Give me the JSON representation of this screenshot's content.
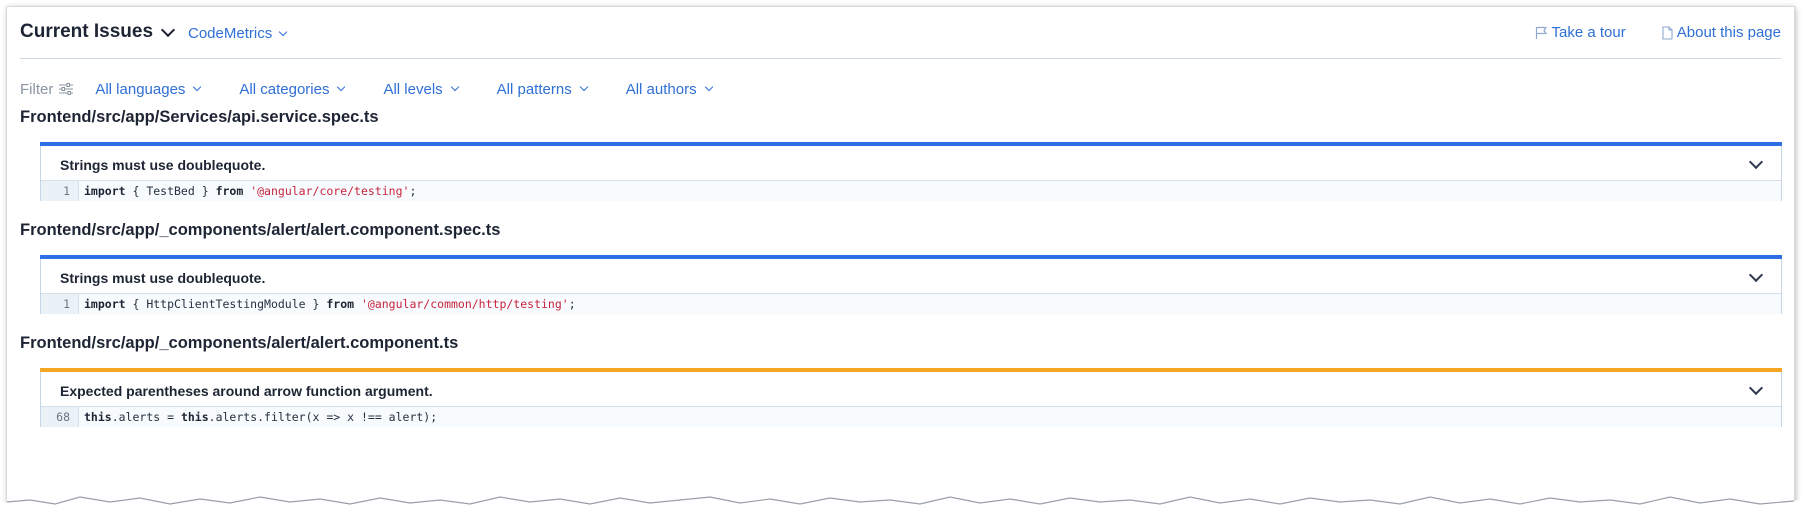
{
  "header": {
    "title": "Current Issues",
    "project": "CodeMetrics",
    "take_tour": "Take a tour",
    "about": "About this page"
  },
  "filters": {
    "label": "Filter",
    "languages": "All languages",
    "categories": "All categories",
    "levels": "All levels",
    "patterns": "All patterns",
    "authors": "All authors"
  },
  "files": [
    {
      "path": "Frontend/src/app/Services/api.service.spec.ts",
      "issue": {
        "message": "Strings must use doublequote.",
        "severity_color": "#2f6fe6",
        "line": "1",
        "code_kw1": "import",
        "code_mid": " { TestBed } ",
        "code_kw2": "from",
        "code_str": "'@angular/core/testing'",
        "code_end": ";"
      }
    },
    {
      "path": "Frontend/src/app/_components/alert/alert.component.spec.ts",
      "issue": {
        "message": "Strings must use doublequote.",
        "severity_color": "#2f6fe6",
        "line": "1",
        "code_kw1": "import",
        "code_mid": " { HttpClientTestingModule } ",
        "code_kw2": "from",
        "code_str": "'@angular/common/http/testing'",
        "code_end": ";"
      }
    },
    {
      "path": "Frontend/src/app/_components/alert/alert.component.ts",
      "issue": {
        "message": "Expected parentheses around arrow function argument.",
        "severity_color": "#f5a623",
        "line": "68",
        "code_kw1": "this",
        "code_mid": ".alerts = ",
        "code_kw2": "this",
        "code_str": "",
        "code_end": ".alerts.filter(x => x !== alert);"
      }
    }
  ],
  "icons": [
    "chevron-down-icon",
    "flag-icon",
    "document-icon",
    "sliders-icon"
  ]
}
